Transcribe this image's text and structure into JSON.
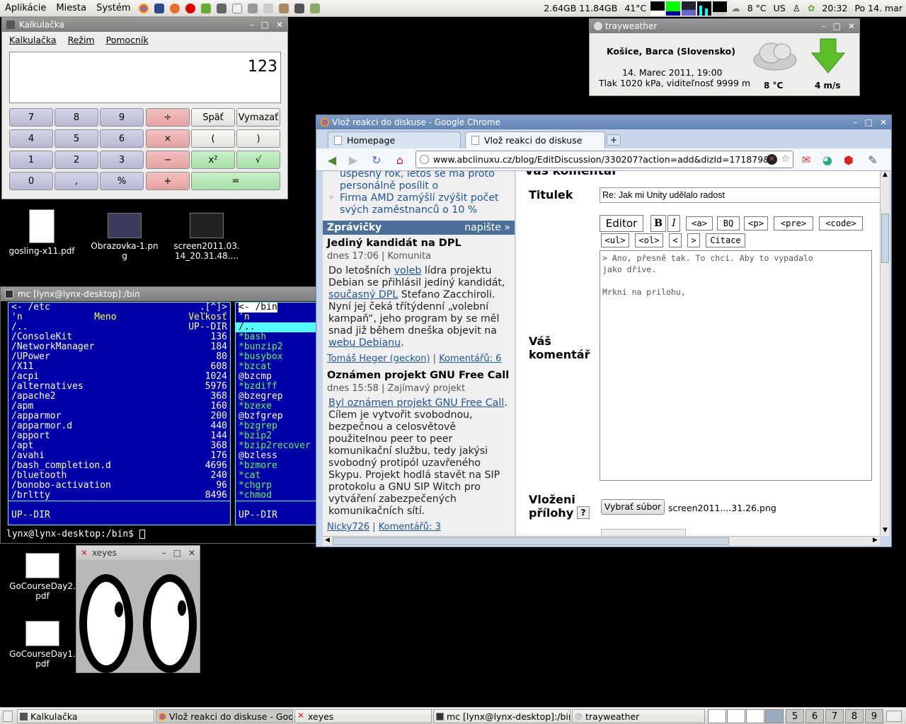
{
  "top_panel": {
    "menus": [
      "Aplikácie",
      "Miesta",
      "Systém"
    ],
    "memory": "2.64GB 11.84GB",
    "cpu_temp": "41°C",
    "weather_temp": "8 °C",
    "keyboard": "US",
    "clock": "20:32",
    "date": "Po 14. mar"
  },
  "calculator": {
    "title": "Kalkulačka",
    "menu": [
      "Kalkulačka",
      "Režim",
      "Pomocník"
    ],
    "display": "123",
    "buttons": [
      "7",
      "8",
      "9",
      "÷",
      "Späť",
      "Vymazať",
      "4",
      "5",
      "6",
      "×",
      "(",
      ")",
      "1",
      "2",
      "3",
      "−",
      "x²",
      "√",
      "0",
      ",",
      "%",
      "+",
      "="
    ]
  },
  "trayweather": {
    "title": "trayweather",
    "location": "Košice, Barca (Slovensko)",
    "datetime": "14. Marec 2011, 19:00",
    "conditions": "Tlak 1020 kPa, viditeľnosť 9999 m",
    "temp": "8 °C",
    "wind": "4 m/s"
  },
  "desktop_icons": [
    "gosling-x11.pdf",
    "Obrazovka-1.png",
    "screen2011.03.14_20.31.48....",
    "GoCourseDay2.pdf",
    "GoCourseDay1.pdf"
  ],
  "mc": {
    "title": "mc [lynx@lynx-desktop]:/bin",
    "left_path": "<- /etc",
    "left_corner": ".[^]>",
    "right_path": "<- /bin",
    "col_n": "'n",
    "col_name": "Meno",
    "col_size": "Veľkosť",
    "left_rows": [
      {
        "name": "/..",
        "size": "UP--DIR"
      },
      {
        "name": "/ConsoleKit",
        "size": "136"
      },
      {
        "name": "/NetworkManager",
        "size": "184"
      },
      {
        "name": "/UPower",
        "size": "80"
      },
      {
        "name": "/X11",
        "size": "608"
      },
      {
        "name": "/acpi",
        "size": "1024"
      },
      {
        "name": "/alternatives",
        "size": "5976"
      },
      {
        "name": "/apache2",
        "size": "368"
      },
      {
        "name": "/apm",
        "size": "160"
      },
      {
        "name": "/apparmor",
        "size": "200"
      },
      {
        "name": "/apparmor.d",
        "size": "440"
      },
      {
        "name": "/apport",
        "size": "144"
      },
      {
        "name": "/apt",
        "size": "368"
      },
      {
        "name": "/avahi",
        "size": "176"
      },
      {
        "name": "/bash_completion.d",
        "size": "4696"
      },
      {
        "name": "/bluetooth",
        "size": "240"
      },
      {
        "name": "/bonobo-activation",
        "size": "96"
      },
      {
        "name": "/brltty",
        "size": "8496"
      }
    ],
    "right_rows": [
      "/..",
      "*bash",
      "*bunzip2",
      "*busybox",
      "*bzcat",
      "@bzcmp",
      "*bzdiff",
      "@bzegrep",
      "*bzexe",
      "@bzfgrep",
      "*bzgrep",
      "*bzip2",
      "*bzip2recover",
      "@bzless",
      "*bzmore",
      "*cat",
      "*chgrp",
      "*chmod"
    ],
    "left_status": "UP--DIR",
    "right_status": "UP--DIR",
    "prompt": "lynx@lynx-desktop:/bin$"
  },
  "xeyes": {
    "title": "xeyes"
  },
  "chrome": {
    "title": "Vlož reakci do diskuse - Google Chrome",
    "tabs": [
      "Homepage",
      "Vlož reakci do diskuse"
    ],
    "url": "www.abclinuxu.cz/blog/EditDiscussion/330207?action=add&dizId=171879&",
    "sidebar": {
      "top_text_1": "úspěšný rok, letos se má proto personálně posílit o",
      "top_item": "Firma AMD zamýšlí zvýšit počet svých zaměstnanců o 10 %",
      "news_header": "Zprávičky",
      "news_header_link": "napište »",
      "items": [
        {
          "title": "Jediný kandidát na DPL",
          "meta": "dnes 17:06 | Komunita",
          "body_1": "Do letošních ",
          "link_1": "voleb",
          "body_2": " lídra projektu Debian se přihlásil jediný kandidát, ",
          "link_2": "současný DPL",
          "body_3": " Stefano Zacchiroli. Nyní jej čeká třítýdenní „volební kampaň“, jeho program by se měl snad již během dneška objevit na ",
          "link_3": "webu Debianu",
          "body_4": ".",
          "author": "Tomáš Heger (geckon)",
          "comments": "Komentářů: 6"
        },
        {
          "title": "Oznámen projekt GNU Free Call",
          "meta": "dnes 15:58 | Zajímavý projekt",
          "link_1": "Byl oznámen projekt GNU Free Call",
          "body_1": ". Cílem je vytvořit svobodnou, bezpečnou a celosvětově použitelnou peer to peer komunikační službu, tedy jakýsi svobodný protipól uzavřeného Skypu. Projekt hodlá stavět na SIP protokolu a GNU SIP Witch pro vytváření zabezpečených komunikačních sítí.",
          "author": "Nicky726",
          "comments": "Komentářů: 3"
        }
      ]
    },
    "form": {
      "heading": "Váš komentář",
      "title_label": "Titulek",
      "title_value": "Re: Jak mi Unity udělalo radost",
      "editor_label": "Editor",
      "format_buttons": [
        "B",
        "I",
        "<a>",
        "BQ",
        "<p>",
        "<pre>",
        "<code>",
        "<ul>",
        "<ol>",
        "<",
        ">",
        "Citace"
      ],
      "comment_label_1": "Váš",
      "comment_label_2": "komentář",
      "comment_line_1": "> Ano, přesně tak. To chci. Aby to vypadalo",
      "comment_line_2": "jako dříve.",
      "comment_line_3": "Mrkni na prilohu,",
      "attach_label_1": "Vloženi",
      "attach_label_2": "přílohy",
      "help": "?",
      "file_button": "Vybrať súbor",
      "file_name": "screen2011....31.26.png"
    }
  },
  "taskbar": {
    "tasks": [
      "Kalkulačka",
      "Vlož reakci do diskuse - Goog",
      "xeyes",
      "mc [lynx@lynx-desktop]:/bin",
      "trayweather"
    ],
    "workspaces": [
      "5",
      "6",
      "7",
      "8",
      "9"
    ]
  },
  "colors": {
    "mc_blue": "#0000a8",
    "mc_cyan": "#54fcfc",
    "mc_green": "#54fc54",
    "link": "#1f55a0",
    "news_header": "#4a6f98"
  }
}
